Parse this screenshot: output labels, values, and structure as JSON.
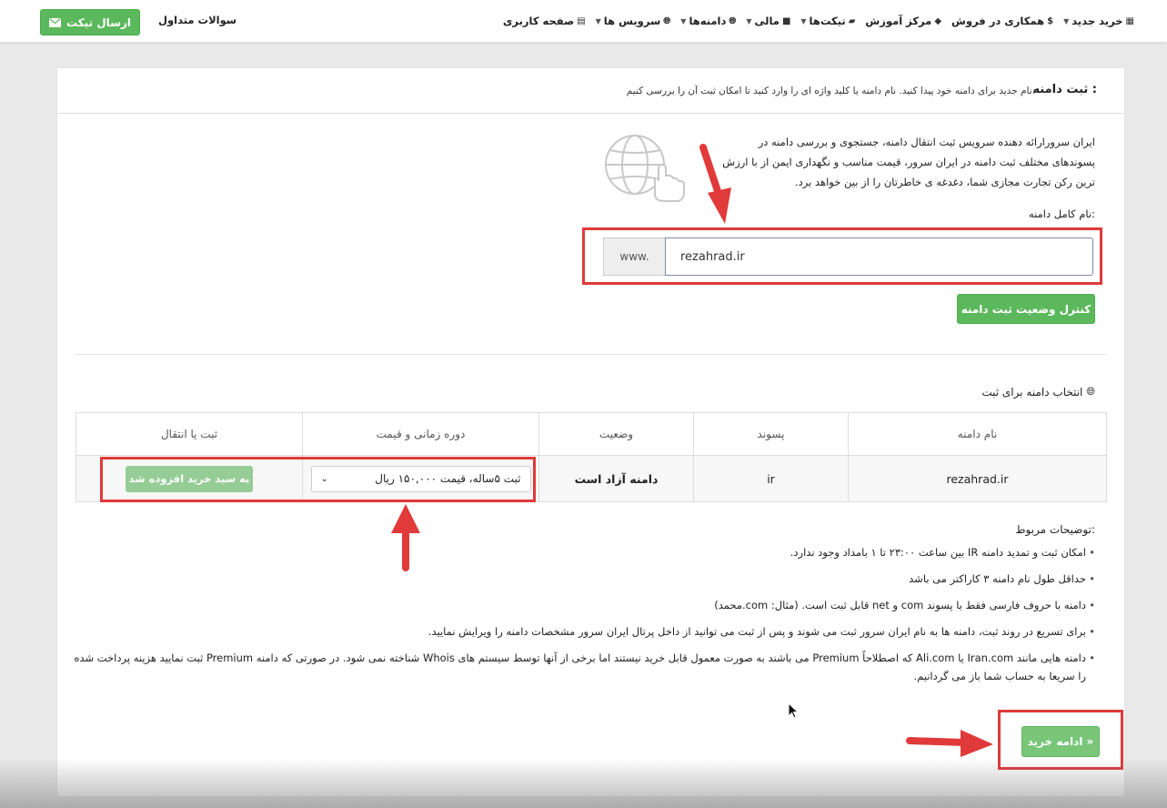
{
  "topbar": {
    "nav": [
      {
        "label": "صفحه کاربری",
        "icon": "dashboard-icon",
        "caret": false
      },
      {
        "label": "سرویس ها",
        "icon": "globe-icon",
        "caret": true
      },
      {
        "label": "دامنه‌ها",
        "icon": "globe-icon",
        "caret": true
      },
      {
        "label": "مالی",
        "icon": "briefcase-icon",
        "caret": true
      },
      {
        "label": "تیکت‌ها",
        "icon": "comments-icon",
        "caret": true
      },
      {
        "label": "مرکز آموزش",
        "icon": "graduation-cap-icon",
        "caret": false
      },
      {
        "label": "همکاری در فروش",
        "icon": "dollar-icon",
        "caret": false
      },
      {
        "label": "خرید جدید",
        "icon": "grid-icon",
        "caret": true
      }
    ],
    "faq_label": "سوالات متداول",
    "ticket_button": "ارسال تیکت"
  },
  "card": {
    "title": "ثبت دامنه :",
    "subtitle": "نام جدید برای دامنه خود پیدا کنید. نام دامنه یا کلید واژه ای را وارد کنید تا امکان ثبت آن را بررسی کنیم.",
    "intro": "ایران سرورارائه دهنده سرویس ثبت انتقال دامنه، جستجوی و بررسی دامنه در پسوندهای مختلف ثبت دامنه در ایران سرور، قیمت مناسب و نگهداری ایمن از با ارزش ترین رکن تجارت مجازی شما، دغدغه ی خاطرتان را از بین خواهد برد.",
    "field_label": "نام کامل دامنه:",
    "www_prefix": "www.",
    "domain_value": "rezahrad.ir",
    "check_button": "کنترل وضعیت ثبت دامنه",
    "select_title": "انتخاب دامنه برای ثبت"
  },
  "table": {
    "headers": [
      "نام دامنه",
      "پسوند",
      "وضعیت",
      "دوره زمانی و قیمت",
      "ثبت یا انتقال"
    ],
    "row": {
      "domain": "rezahrad.ir",
      "tld": "ir",
      "status": "دامنه آزاد است",
      "period": "ثبت ۵ساله، قیمت ۱۵۰,۰۰۰ ریال",
      "action": "به سبد خرید افزوده شد"
    }
  },
  "notes": {
    "title": "توضیحات مربوط:",
    "items": [
      "امکان ثبت و تمدید دامنه IR بین ساعت ۲۳:۰۰ تا ۱ بامداد وجود ندارد.",
      "حداقل طول نام دامنه ۳ کاراکتر می باشد",
      "دامنه با حروف فارسی فقط با پسوند com و net قابل ثبت است. (مثال: com.محمد)",
      "برای تسریع در روند ثبت، دامنه ها به نام ایران سرور ثبت می شوند و پس از ثبت می توانید از داخل پرتال ایران سرور مشخصات دامنه را ویرایش نمایید.",
      "دامنه هایی مانند Iran.com یا Ali.com که اصطلاحاً Premium می باشند به صورت معمول قابل خرید نیستند اما برخی از آنها توسط سیستم های Whois شناخته نمی شود. در صورتی که دامنه Premium ثبت نمایید هزینه پرداخت شده را سریعا به حساب شما باز می گردانیم."
    ]
  },
  "continue_button": "ادامه خرید »",
  "colors": {
    "primary_green": "#5cb85c",
    "disabled_green": "#96cd96",
    "highlight_red": "#e03a3a"
  }
}
